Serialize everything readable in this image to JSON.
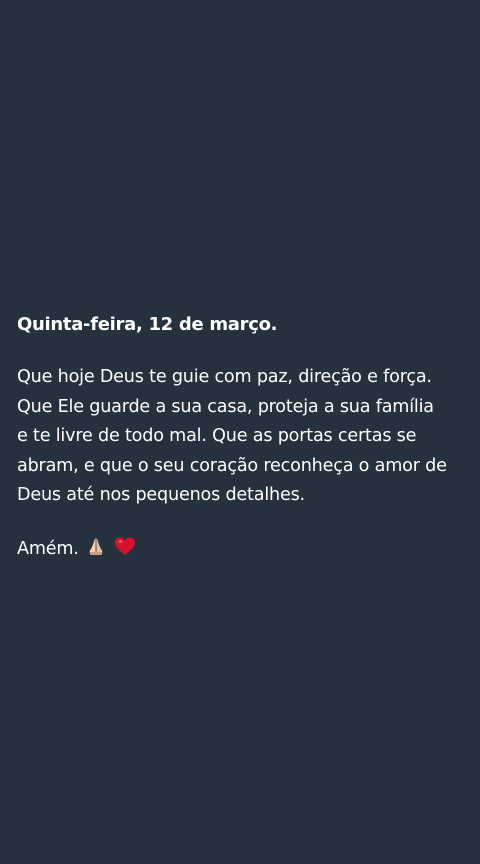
{
  "status": {
    "title": "Quinta-feira, 12 de março.",
    "lines": [
      "Que hoje Deus te guie com paz, direção e força.",
      "Que Ele guarde a sua casa, proteja a sua família",
      "e te livre de todo mal. Que as portas certas se",
      "abram, e que o seu coração reconheça o amor de",
      "Deus até nos pequenos detalhes."
    ],
    "closing": "Amém.",
    "emojis": [
      "praying-hands-icon",
      "red-heart-icon"
    ]
  },
  "colors": {
    "background": "#25313c",
    "text": "#ffffff",
    "heart": "#d8112b"
  }
}
